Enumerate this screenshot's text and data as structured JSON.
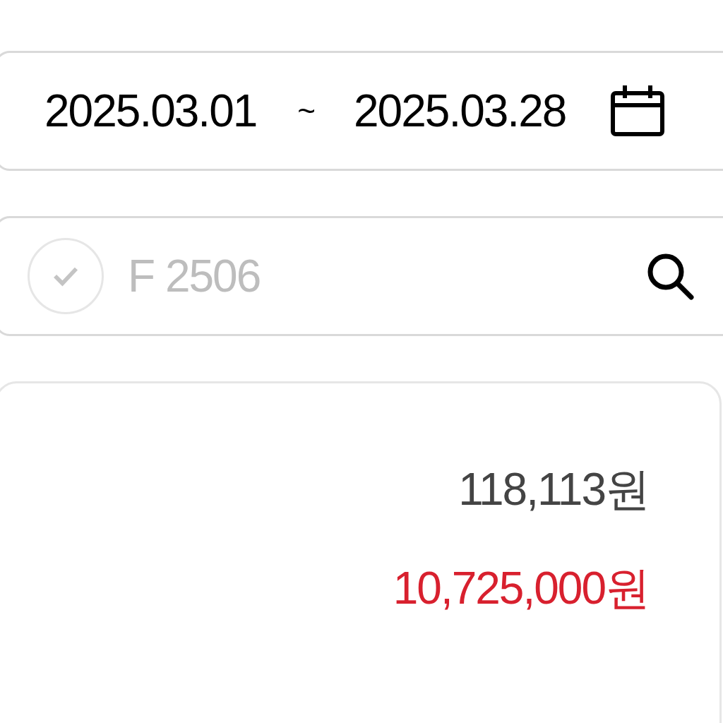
{
  "date_range": {
    "start": "2025.03.01",
    "separator": "~",
    "end": "2025.03.28"
  },
  "search": {
    "checked": false,
    "placeholder": "F 2506"
  },
  "summary": {
    "amounts": [
      {
        "value": "118,113원",
        "kind": "normal"
      },
      {
        "value": "10,725,000원",
        "kind": "highlight"
      }
    ]
  }
}
